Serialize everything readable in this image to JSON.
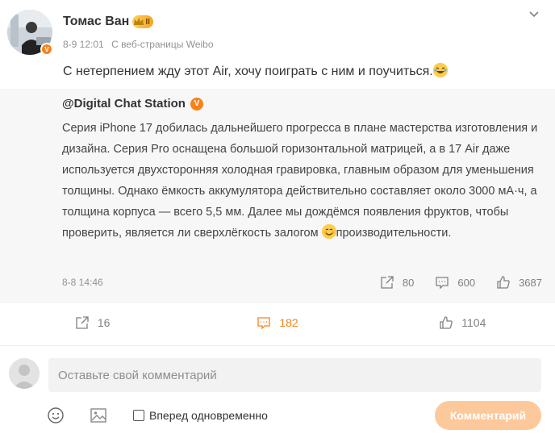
{
  "post": {
    "author": "Томас Ван",
    "vip_level": "II",
    "date": "8-9 12:01",
    "source": "С веб-страницы Weibo",
    "text": "С нетерпением жду этот Air, хочу поиграть с ним и поучиться."
  },
  "repost": {
    "author": "@Digital Chat Station",
    "text_main": "Серия iPhone 17 добилась дальнейшего прогресса в плане мастерства изготовления и дизайна. Серия Pro оснащена большой горизонтальной матрицей, а в 17 Air даже используется двухсторонняя холодная гравировка, главным образом для уменьшения толщины. Однако ёмкость аккумулятора действительно составляет около 3000 мА·ч, а толщина корпуса — всего 5,5 мм. Далее мы дождёмся появления фруктов, чтобы проверить, является ли сверхлёгкость залогом ",
    "text_tail": "производительности.",
    "date": "8-8 14:46",
    "reposts": "80",
    "comments": "600",
    "likes": "3687"
  },
  "actions": {
    "reposts": "16",
    "comments": "182",
    "likes": "1104"
  },
  "comment_box": {
    "placeholder": "Оставьте свой комментарий",
    "also_repost_label": "Вперед одновременно",
    "submit_label": "Комментарий"
  },
  "colors": {
    "accent": "#f7821b",
    "repost_bg": "#f7f7f7",
    "submit_bg": "#fdc99a"
  },
  "icons": [
    "chevron-down-icon",
    "repost-icon",
    "comment-icon",
    "like-icon",
    "emoji-icon",
    "image-icon",
    "verified-icon"
  ]
}
